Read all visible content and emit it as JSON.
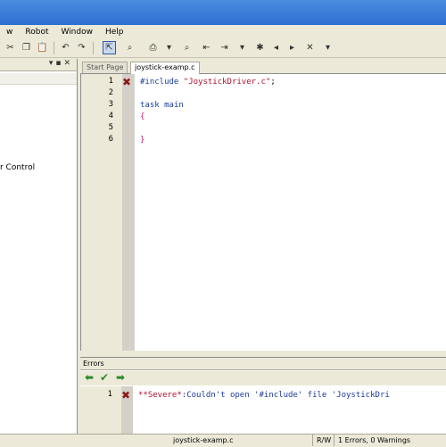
{
  "menubar": {
    "items": [
      "w",
      "Robot",
      "Window",
      "Help"
    ]
  },
  "tabs": [
    {
      "label": "Start Page",
      "active": false
    },
    {
      "label": "joystick-examp.c",
      "active": true
    }
  ],
  "left_panel": {
    "partial_item": "r Control"
  },
  "editor": {
    "line_numbers": [
      "1",
      "2",
      "3",
      "4",
      "5",
      "6"
    ],
    "code": {
      "include_directive": "#include",
      "include_file": "\"JoystickDriver.c\"",
      "include_semicolon": ";",
      "task_keyword": "task",
      "task_name": "main",
      "open_brace": "{",
      "close_brace": "}"
    }
  },
  "errors_panel": {
    "title": "Errors",
    "line_number": "1",
    "severity": "**Severe*",
    "message": ":Couldn't open '#include' file 'JoystickDri"
  },
  "statusbar": {
    "filename": "joystick-examp.c",
    "mode": "R/W",
    "summary": "1 Errors, 0 Warnings"
  },
  "colors": {
    "keyword": "#1a3a9a",
    "string": "#b01030",
    "error_mark": "#8b1a1a",
    "nav_arrow": "#2e8b2e"
  }
}
